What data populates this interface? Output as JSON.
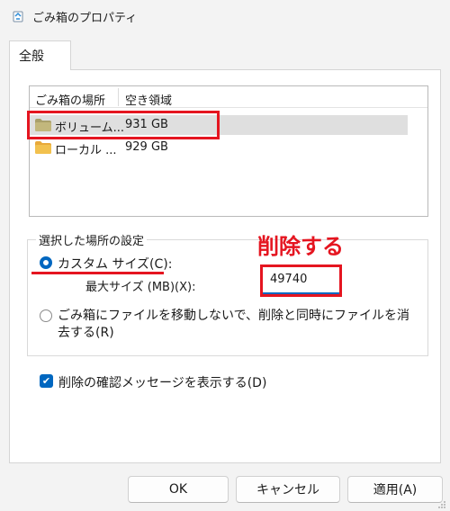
{
  "window": {
    "title": "ごみ箱のプロパティ",
    "icon": "recycle-bin-icon"
  },
  "tabs": [
    {
      "label": "全般",
      "selected": true
    }
  ],
  "locations": {
    "columns": [
      "ごみ箱の場所",
      "空き領域"
    ],
    "rows": [
      {
        "name": "ボリューム...",
        "free": "931 GB",
        "selected": true
      },
      {
        "name": "ローカル ...",
        "free": "929 GB",
        "selected": false
      }
    ]
  },
  "settings": {
    "legend": "選択した場所の設定",
    "custom_size_label": "カスタム サイズ(C):",
    "custom_size_selected": true,
    "max_size_label": "最大サイズ (MB)(X):",
    "max_size_value": "49740",
    "no_move_label": "ごみ箱にファイルを移動しないで、削除と同時にファイルを消去する(R)",
    "no_move_selected": false
  },
  "confirm_delete": {
    "label": "削除の確認メッセージを表示する(D)",
    "checked": true
  },
  "annotation": {
    "text": "削除する",
    "color": "#e51520"
  },
  "buttons": {
    "ok": "OK",
    "cancel": "キャンセル",
    "apply": "適用(A)"
  },
  "colors": {
    "accent": "#0067c0",
    "highlight": "#e51520",
    "folder": "#f2c14e"
  }
}
